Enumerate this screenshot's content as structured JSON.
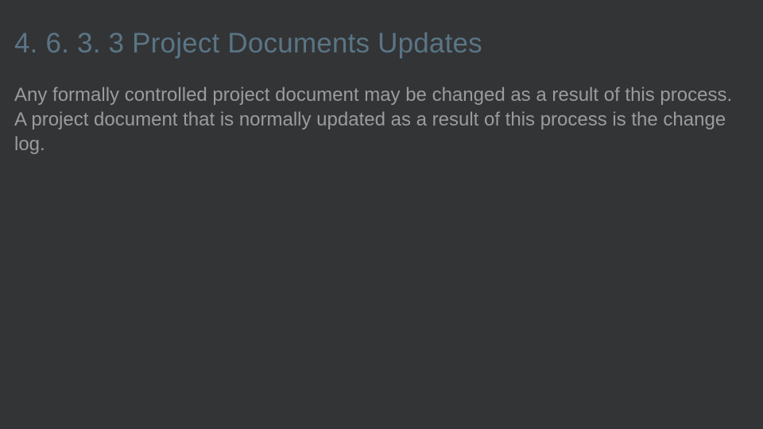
{
  "slide": {
    "heading": "4. 6. 3. 3 Project Documents Updates",
    "body": "Any formally controlled project document may be changed as a result of this process. A project document that is normally updated as a result of this process is the change log."
  }
}
